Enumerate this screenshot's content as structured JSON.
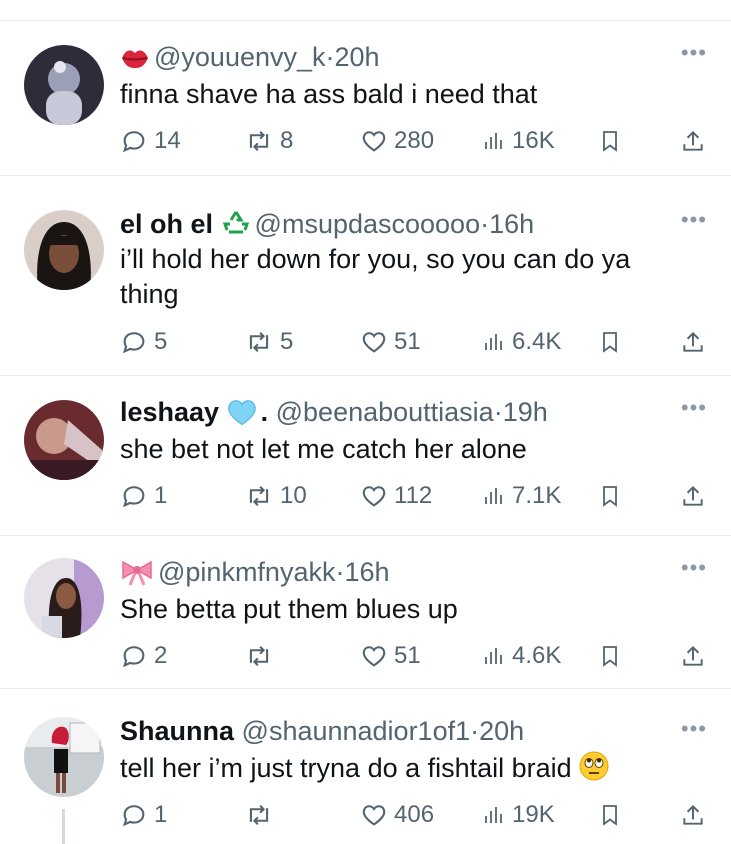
{
  "tweets": [
    {
      "name": "",
      "badge": "lips",
      "handle": "@youuenvy_k",
      "time": "20h",
      "text": "finna shave ha ass bald i need that",
      "replies": "14",
      "reposts": "8",
      "likes": "280",
      "views": "16K"
    },
    {
      "name": "el oh el",
      "badge": "recycle",
      "handle": "@msupdascooooo",
      "time": "16h",
      "text": "i’ll hold her down for you, so you can do ya thing",
      "replies": "5",
      "reposts": "5",
      "likes": "51",
      "views": "6.4K"
    },
    {
      "name": "leshaay",
      "badge": "light-blue-heart",
      "name_suffix": ".",
      "handle": "@beenabouttiasia",
      "time": "19h",
      "text": "she bet not let me catch her alone",
      "replies": "1",
      "reposts": "10",
      "likes": "112",
      "views": "7.1K"
    },
    {
      "name": "",
      "badge": "ribbon",
      "handle": "@pinkmfnyakk",
      "time": "16h",
      "text": "She betta put them blues up",
      "replies": "2",
      "reposts": "",
      "likes": "51",
      "views": "4.6K"
    },
    {
      "name": "Shaunna",
      "badge": "",
      "handle": "@shaunnadior1of1",
      "time": "20h",
      "text": "tell her i’m just tryna do a fishtail braid",
      "text_emoji": "face-with-rolling-eyes",
      "replies": "1",
      "reposts": "",
      "likes": "406",
      "views": "19K"
    }
  ],
  "colors": {
    "text": "#0f1419",
    "secondary": "#536471",
    "divider": "#eceff1",
    "icon": "#536471"
  },
  "sep": "·",
  "more_glyph": "•••"
}
